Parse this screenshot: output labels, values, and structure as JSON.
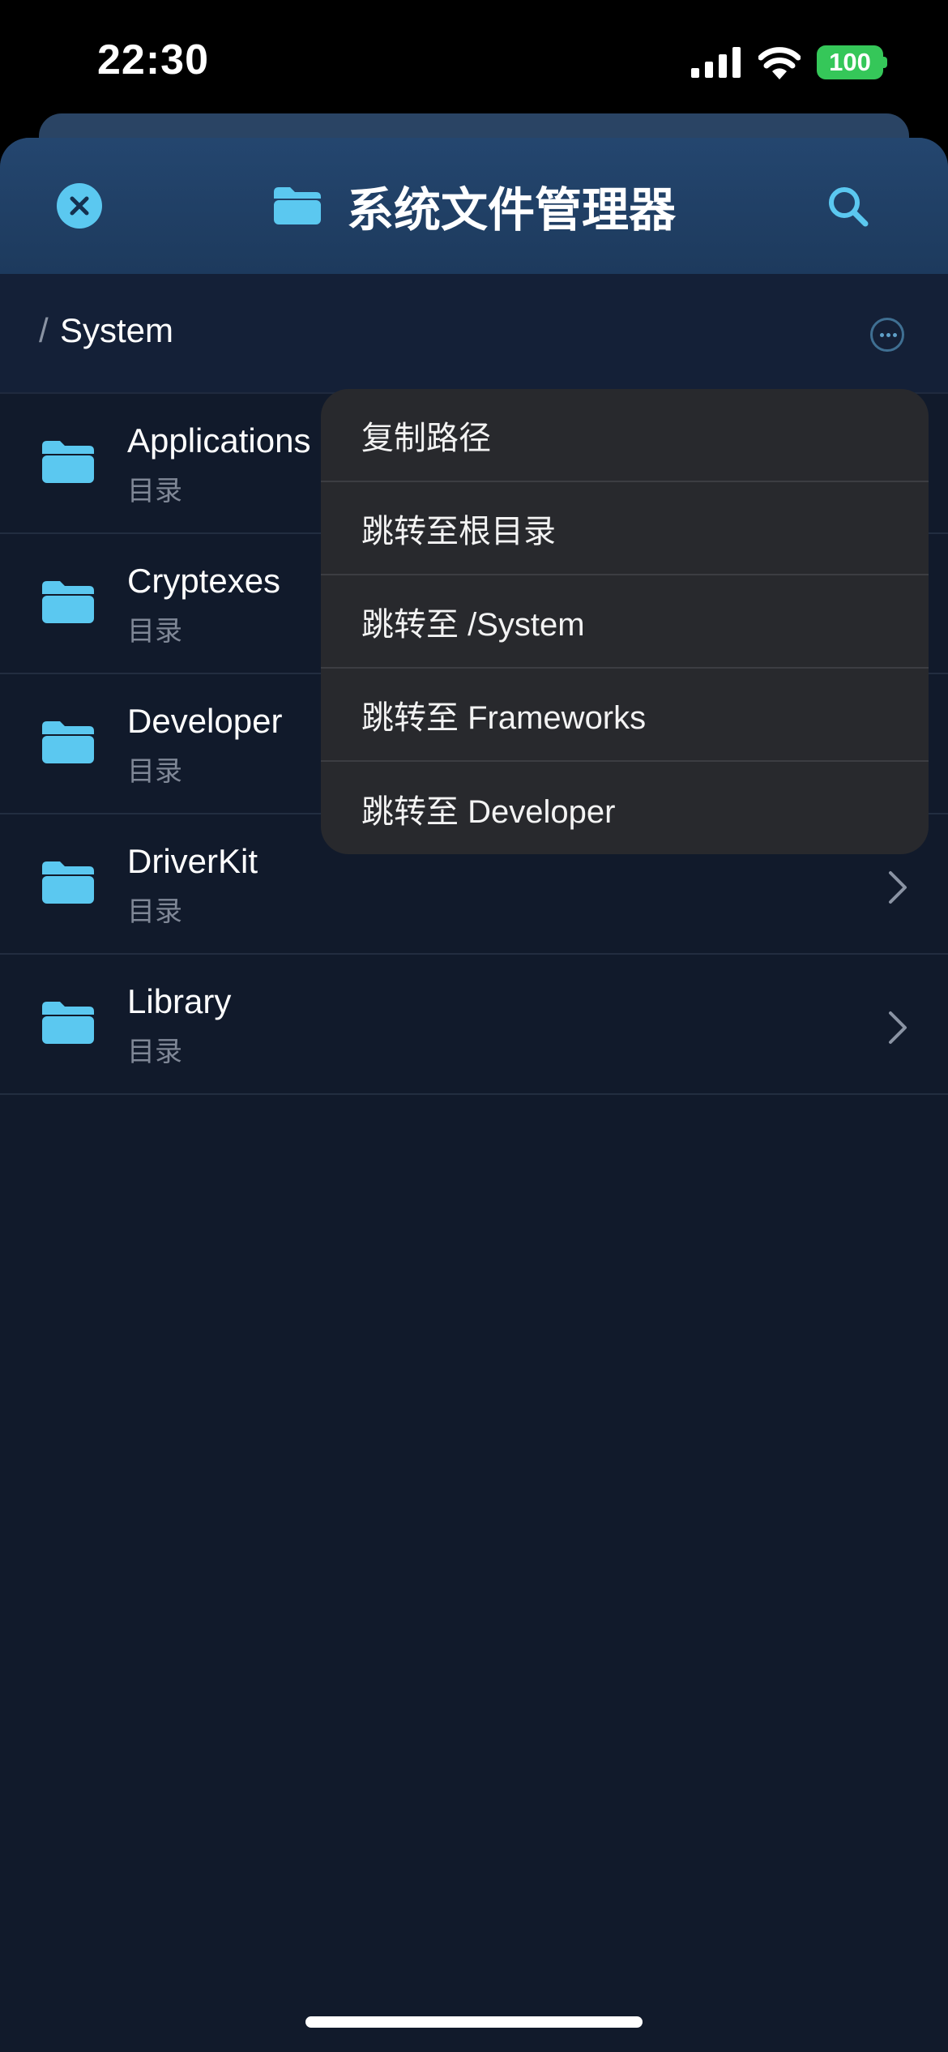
{
  "status_bar": {
    "time": "22:30",
    "battery": "100"
  },
  "nav": {
    "title": "系统文件管理器",
    "accent_color": "#5bc8f0"
  },
  "path": {
    "separator": "/",
    "current": "System"
  },
  "files": [
    {
      "name": "Applications",
      "type": "目录"
    },
    {
      "name": "Cryptexes",
      "type": "目录"
    },
    {
      "name": "Developer",
      "type": "目录"
    },
    {
      "name": "DriverKit",
      "type": "目录"
    },
    {
      "name": "Library",
      "type": "目录"
    }
  ],
  "menu": {
    "items": [
      "复制路径",
      "跳转至根目录",
      "跳转至 /System",
      "跳转至 Frameworks",
      "跳转至 Developer"
    ]
  }
}
